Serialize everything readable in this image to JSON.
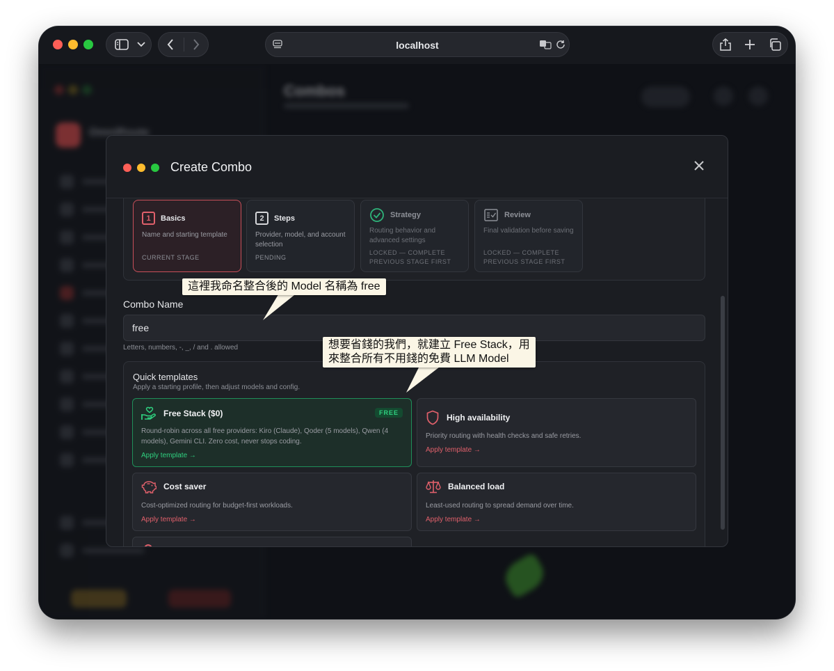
{
  "browser": {
    "address": "localhost",
    "traffic_colors": [
      "#fe5f57",
      "#febc2e",
      "#28c840"
    ]
  },
  "modal": {
    "title": "Create Combo",
    "stages": [
      {
        "num": "1",
        "name": "Basics",
        "desc": "Name and starting template",
        "status": "CURRENT STAGE",
        "state": "current"
      },
      {
        "num": "2",
        "name": "Steps",
        "desc": "Provider, model, and account selection",
        "status": "PENDING",
        "state": "pending"
      },
      {
        "name": "Strategy",
        "desc": "Routing behavior and advanced settings",
        "status_line1": "LOCKED — COMPLETE",
        "status_line2": "PREVIOUS STAGE FIRST",
        "state": "locked",
        "icon": "check-circle-icon"
      },
      {
        "name": "Review",
        "desc": "Final validation before saving",
        "status_line1": "LOCKED — COMPLETE",
        "status_line2": "PREVIOUS STAGE FIRST",
        "state": "locked",
        "icon": "checklist-icon"
      }
    ],
    "combo_name": {
      "label": "Combo Name",
      "value": "free",
      "help": "Letters, numbers, -, _, / and . allowed"
    },
    "templates": {
      "title": "Quick templates",
      "subtitle": "Apply a starting profile, then adjust models and config.",
      "cards": [
        {
          "name": "Free Stack ($0)",
          "badge": "FREE",
          "desc": "Round-robin across all free providers: Kiro (Claude), Qoder (5 models), Qwen (4 models), Gemini CLI. Zero cost, never stops coding.",
          "apply": "Apply template →",
          "icon": "hand-heart-icon"
        },
        {
          "name": "High availability",
          "desc": "Priority routing with health checks and safe retries.",
          "apply": "Apply template →",
          "icon": "shield-icon"
        },
        {
          "name": "Cost saver",
          "desc": "Cost-optimized routing for budget-first workloads.",
          "apply": "Apply template →",
          "icon": "piggy-bank-icon"
        },
        {
          "name": "Balanced load",
          "desc": "Least-used routing to spread demand over time.",
          "apply": "Apply template →",
          "icon": "scale-icon"
        }
      ]
    },
    "colors": {
      "accent": "#e0606b",
      "free_green": "#2fd07f"
    }
  },
  "annotations": {
    "name_callout": "這裡我命名整合後的 Model 名稱為 free",
    "stack_callout_line1": "想要省錢的我們，就建立 Free Stack，用",
    "stack_callout_line2": "來整合所有不用錢的免費 LLM Model"
  }
}
